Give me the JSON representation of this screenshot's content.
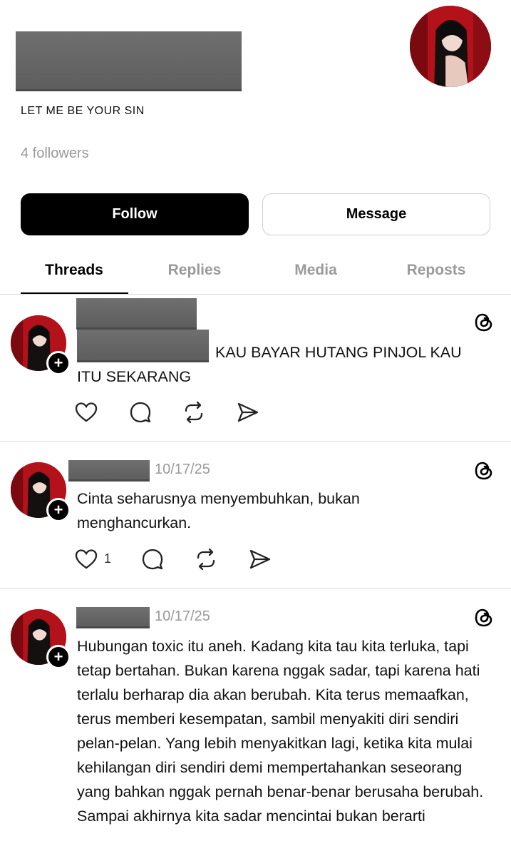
{
  "profile": {
    "bio": "LET ME BE YOUR SIN",
    "followers": "4 followers",
    "follow_label": "Follow",
    "message_label": "Message"
  },
  "tabs": [
    {
      "label": "Threads",
      "active": true
    },
    {
      "label": "Replies",
      "active": false
    },
    {
      "label": "Media",
      "active": false
    },
    {
      "label": "Reposts",
      "active": false
    }
  ],
  "posts": [
    {
      "date": "",
      "text_line1": "KAU BAYAR HUTANG PINJOL KAU",
      "text_rest": "ITU SEKARANG",
      "likes": ""
    },
    {
      "date": "10/17/25",
      "text": "Cinta seharusnya menyembuhkan, bukan menghancurkan.",
      "likes": "1"
    },
    {
      "date": "10/17/25",
      "text": "Hubungan toxic itu aneh. Kadang kita tau kita terluka, tapi tetap bertahan. Bukan karena nggak sadar, tapi karena hati terlalu berharap dia akan berubah. Kita terus memaafkan, terus memberi kesempatan, sambil menyakiti diri sendiri pelan-pelan. Yang lebih menyakitkan lagi, ketika kita mulai kehilangan diri sendiri demi mempertahankan seseorang yang bahkan nggak pernah benar-benar berusaha berubah. Sampai akhirnya kita sadar mencintai bukan berarti",
      "likes": ""
    }
  ],
  "colors": {
    "accent": "#000000",
    "muted": "#9a9a9a",
    "avatar_bg": "#c4151c"
  },
  "icons": [
    "heart-icon",
    "comment-icon",
    "repost-icon",
    "share-icon",
    "threads-logo-icon",
    "plus-icon"
  ]
}
